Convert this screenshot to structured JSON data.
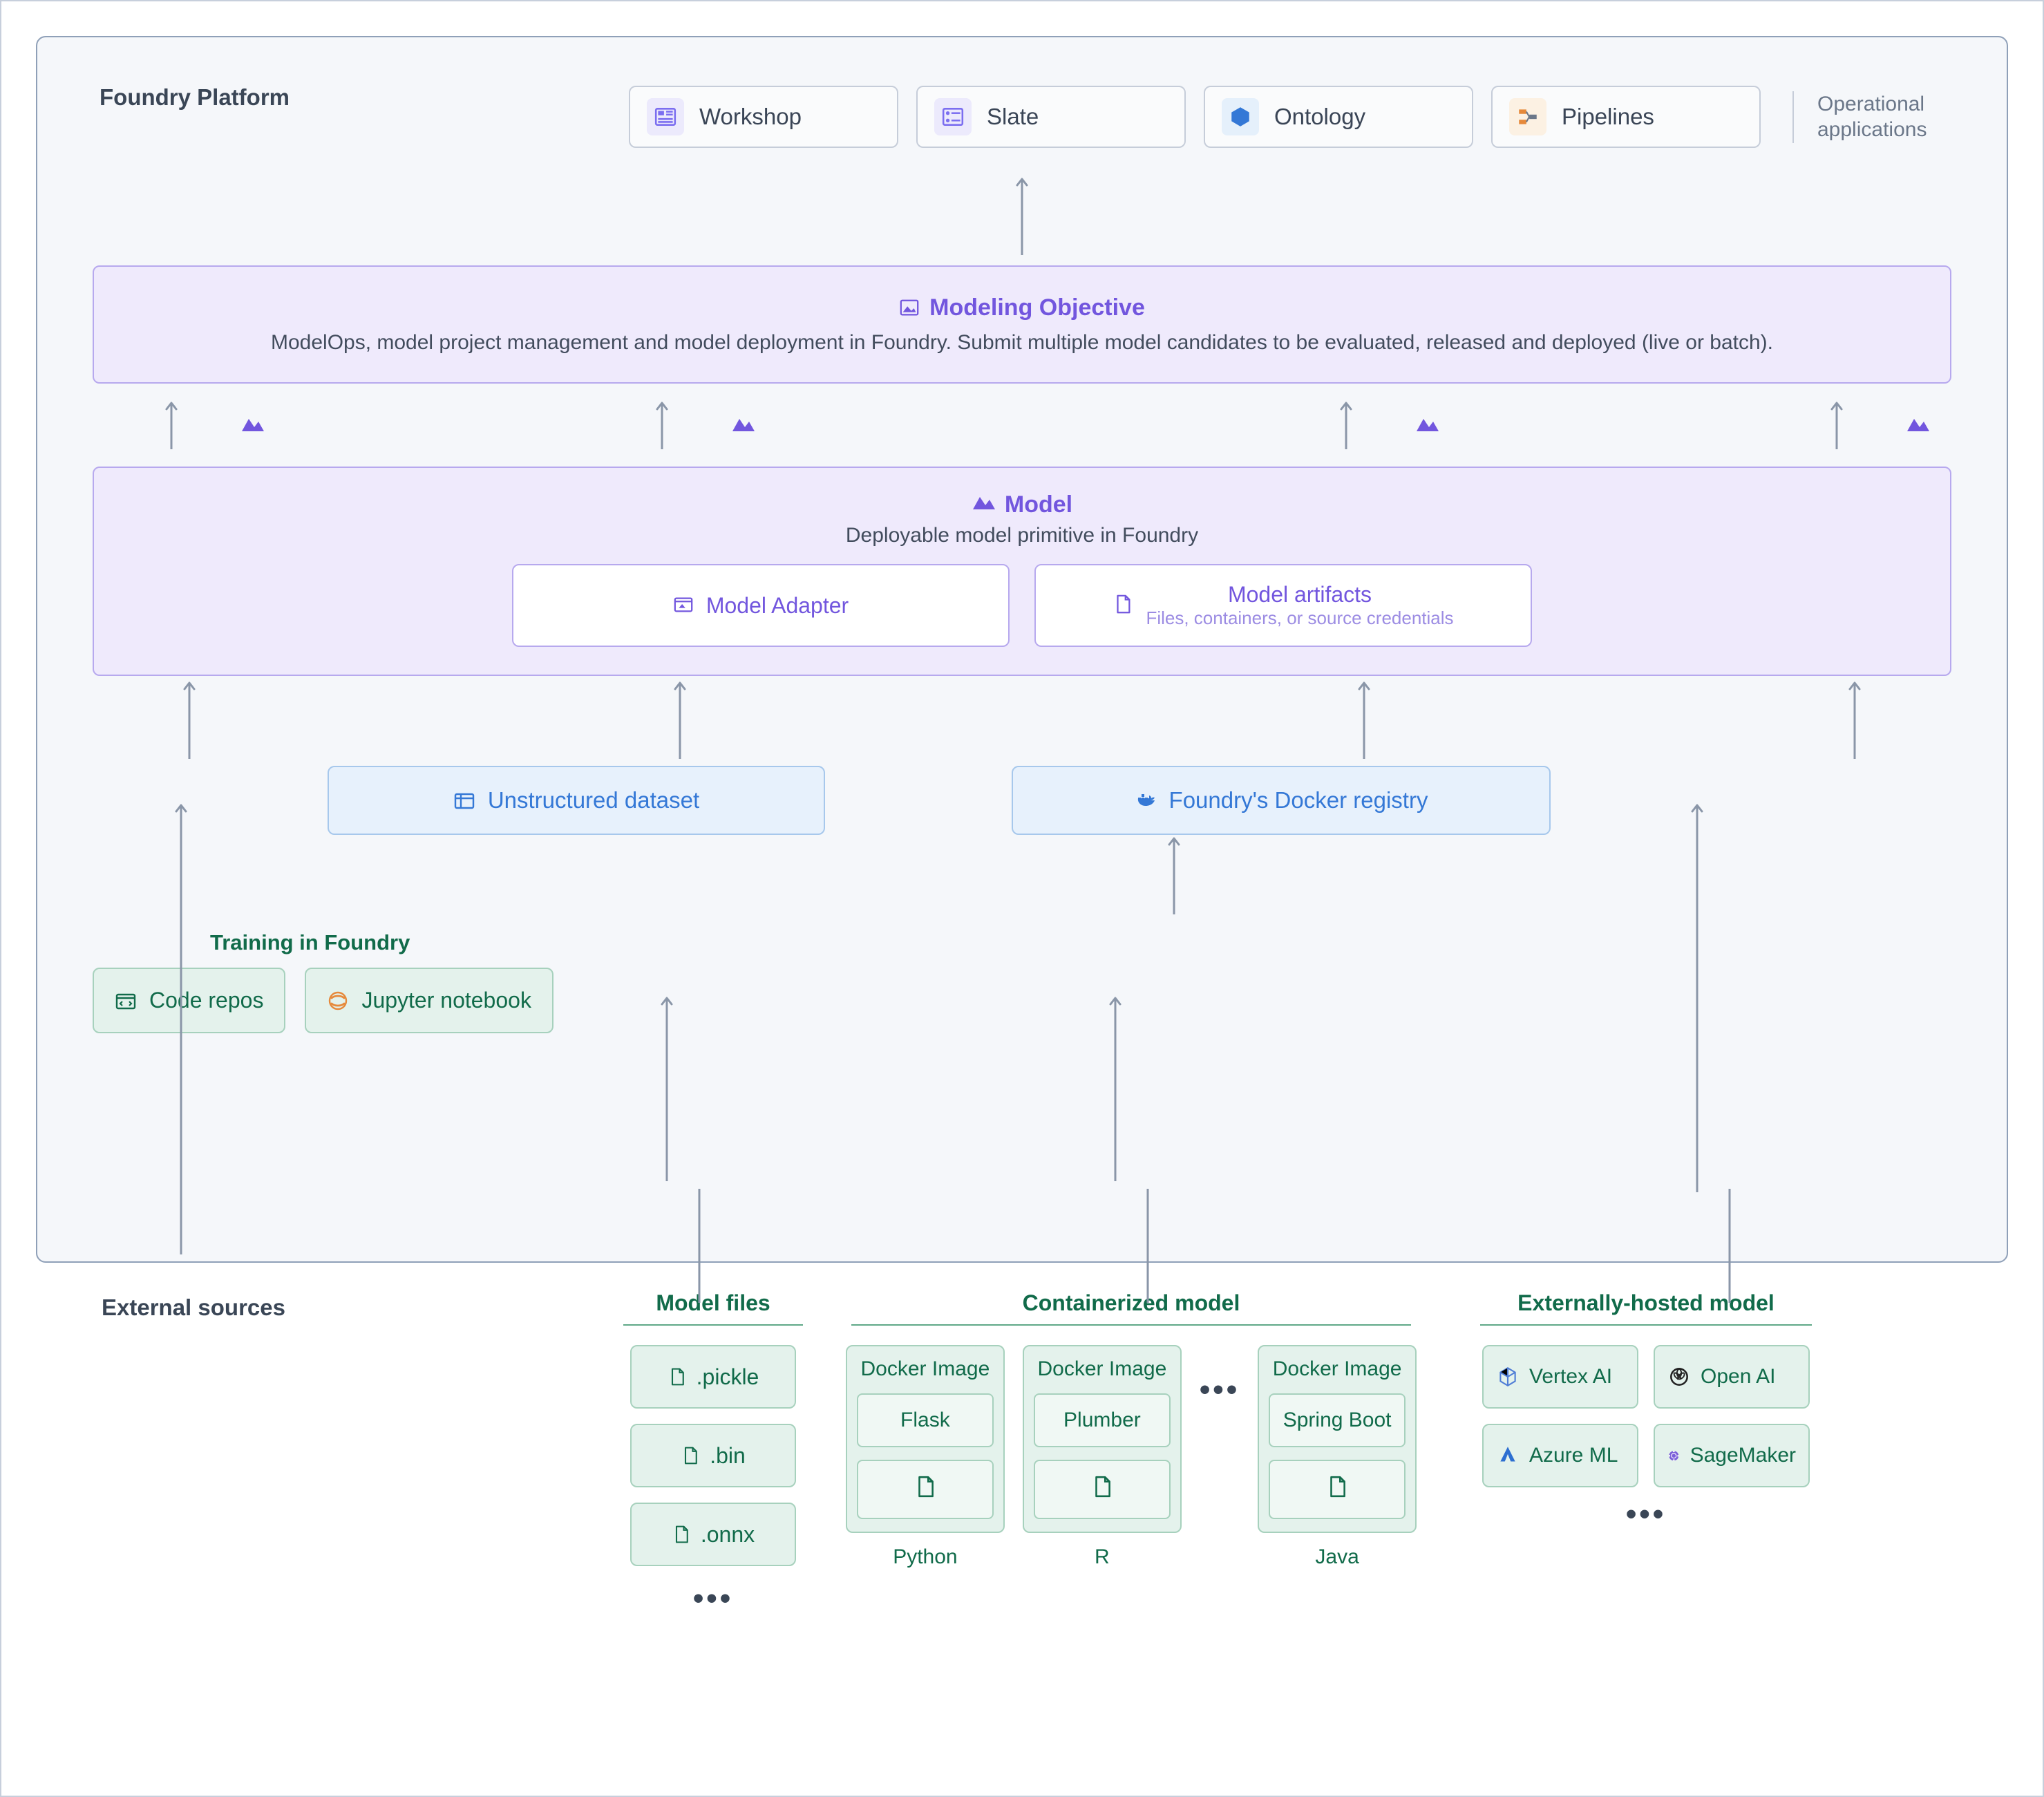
{
  "platform_title": "Foundry Platform",
  "apps": {
    "workshop": "Workshop",
    "slate": "Slate",
    "ontology": "Ontology",
    "pipelines": "Pipelines",
    "op_apps": "Operational applications"
  },
  "objective": {
    "title": "Modeling Objective",
    "desc": "ModelOps, model project management and model deployment in Foundry. Submit multiple model candidates to be evaluated, released and deployed (live or batch)."
  },
  "model": {
    "title": "Model",
    "sub": "Deployable model primitive in Foundry",
    "adapter": "Model Adapter",
    "artifacts_t": "Model artifacts",
    "artifacts_s": "Files, containers, or source credentials"
  },
  "blue": {
    "unstructured": "Unstructured dataset",
    "docker": "Foundry's Docker registry"
  },
  "training": {
    "label": "Training in Foundry",
    "code": "Code repos",
    "jupyter": "Jupyter notebook"
  },
  "external_label": "External sources",
  "files": {
    "title": "Model files",
    "f1": ".pickle",
    "f2": ".bin",
    "f3": ".onnx"
  },
  "cont": {
    "title": "Containerized model",
    "docker_image": "Docker Image",
    "flask": "Flask",
    "plumber": "Plumber",
    "spring": "Spring Boot",
    "python": "Python",
    "r": "R",
    "java": "Java"
  },
  "extm": {
    "title": "Externally-hosted model",
    "vertex": "Vertex AI",
    "openai": "Open AI",
    "azure": "Azure ML",
    "sagemaker": "SageMaker"
  },
  "ellipsis": "•••"
}
